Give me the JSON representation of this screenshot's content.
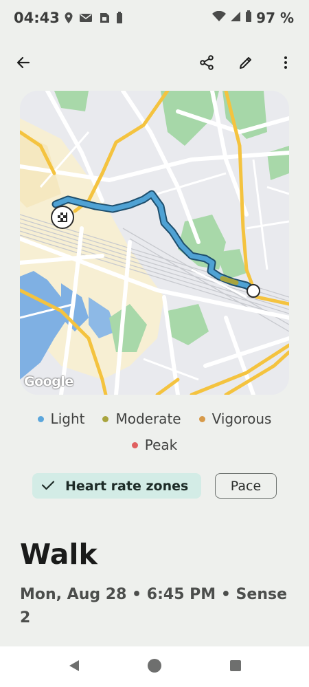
{
  "status_bar": {
    "time": "04:43",
    "battery": "97 %",
    "icons": [
      "location-icon",
      "mail-icon",
      "sim-icon",
      "battery-small-icon",
      "wifi-icon",
      "signal-icon",
      "battery-icon"
    ]
  },
  "toolbar": {
    "back": "back-arrow-icon",
    "share": "share-icon",
    "edit": "edit-icon",
    "more": "more-vert-icon"
  },
  "map": {
    "attribution": "Google",
    "route_color": "#4fa2d4"
  },
  "legend": [
    {
      "label": "Light",
      "color": "#5ba6dc"
    },
    {
      "label": "Moderate",
      "color": "#a8a43e"
    },
    {
      "label": "Vigorous",
      "color": "#d79a4a"
    },
    {
      "label": "Peak",
      "color": "#e06060"
    }
  ],
  "chips": {
    "heart_rate": "Heart rate zones",
    "pace": "Pace"
  },
  "activity": {
    "title": "Walk",
    "subtitle": "Mon, Aug 28 • 6:45 PM • Sense 2"
  },
  "colors": {
    "background": "#eef0ed",
    "chip_selected": "#d3ece6"
  }
}
